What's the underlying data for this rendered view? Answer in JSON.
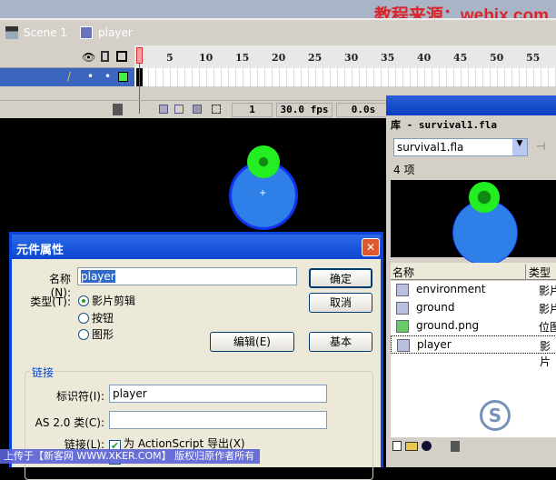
{
  "watermark_top": "教程来源：webjx.com",
  "watermark_bottom": "上传于【新客网 WWW.XKER.COM】 版权归原作者所有",
  "breadcrumb": {
    "scene": "Scene 1",
    "symbol": "player"
  },
  "timeline": {
    "ticks": [
      "1",
      "5",
      "10",
      "15",
      "20",
      "25",
      "30",
      "35",
      "40",
      "45",
      "50",
      "55"
    ],
    "current_frame": "1",
    "fps": "30.0 fps",
    "time": "0.0s"
  },
  "library": {
    "title": "库 - survival1.fla",
    "dropdown": "survival1.fla",
    "count": "4 项",
    "col_name": "名称",
    "col_type": "类型",
    "items": [
      {
        "name": "environment",
        "type": "影片",
        "icon": "movieclip-icon"
      },
      {
        "name": "ground",
        "type": "影片",
        "icon": "movieclip-icon"
      },
      {
        "name": "ground.png",
        "type": "位图",
        "icon": "bitmap-icon"
      },
      {
        "name": "player",
        "type": "影片",
        "icon": "movieclip-icon"
      }
    ]
  },
  "dialog": {
    "title": "元件属性",
    "name_label": "名称(N):",
    "name_value": "player",
    "type_label": "类型(T):",
    "types": [
      "影片剪辑",
      "按钮",
      "图形"
    ],
    "selected_type": "影片剪辑",
    "ok": "确定",
    "cancel": "取消",
    "edit": "编辑(E)",
    "basic": "基本",
    "linkage_group": "链接",
    "identifier_label": "标识符(I):",
    "identifier_value": "player",
    "class_label": "AS 2.0 类(C):",
    "class_value": "",
    "linkage_label": "链接(L):",
    "export_as": "为 ActionScript 导出(X)",
    "export_checked": true
  },
  "colors": {
    "green": "#22ee22",
    "blue": "#1133ee",
    "lightblue": "#2e7fe8",
    "title_blue": "#0a46d8"
  }
}
